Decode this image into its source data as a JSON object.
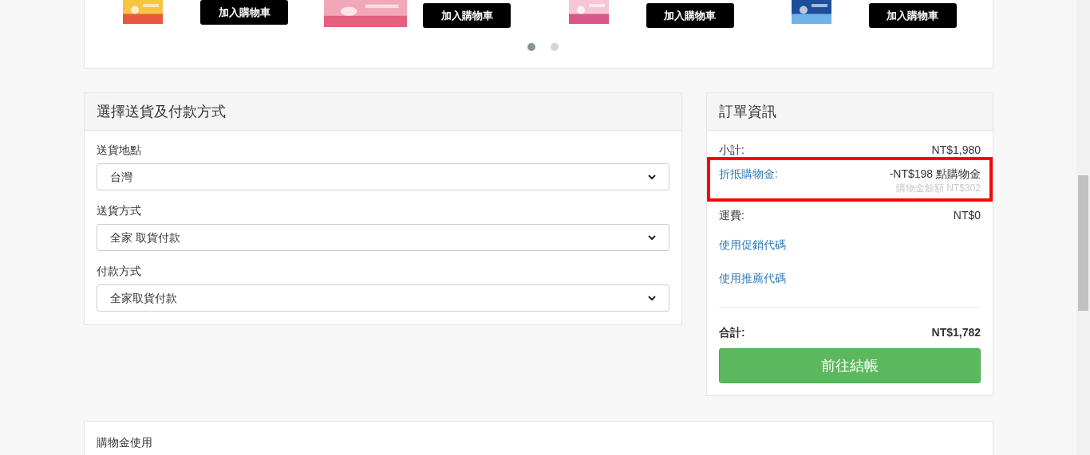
{
  "carousel": {
    "products": [
      {
        "kind": "picture",
        "button": "加入購物車"
      },
      {
        "kind": "picture",
        "button": "加入購物車"
      },
      {
        "kind": "picture",
        "button": "加入購物車"
      },
      {
        "kind": "picture",
        "button": "加入購物車"
      }
    ],
    "dots": [
      {
        "selected": true
      },
      {
        "selected": false
      }
    ]
  },
  "shipping_panel": {
    "title": "選擇送貨及付款方式",
    "fields": [
      {
        "label": "送貨地點",
        "value": "台灣"
      },
      {
        "label": "送貨方式",
        "value": "全家 取貨付款"
      },
      {
        "label": "付款方式",
        "value": "全家取貨付款"
      }
    ]
  },
  "order_panel": {
    "title": "訂單資訊",
    "subtotal": {
      "label": "小計:",
      "value": "NT$1,980"
    },
    "credit": {
      "label": "折抵購物金:",
      "value": "-NT$198 點購物金",
      "note": "購物金餘額 NT$302",
      "highlighted": true
    },
    "shipping": {
      "label": "運費:",
      "value": "NT$0"
    },
    "links": [
      "使用促銷代碼",
      "使用推薦代碼"
    ],
    "total": {
      "label": "合計:",
      "value": "NT$1,782"
    },
    "checkout_button": "前往結帳"
  },
  "info_panel": {
    "title": "購物金使用"
  }
}
